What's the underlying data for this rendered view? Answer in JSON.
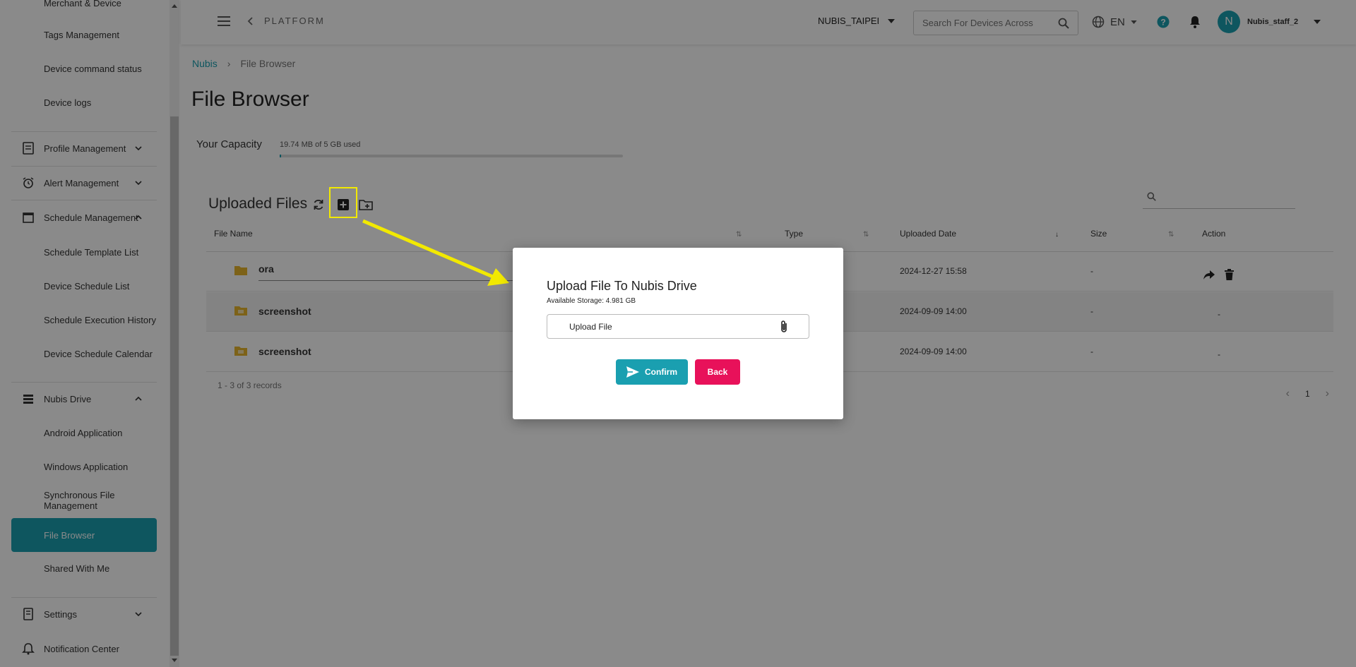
{
  "sidebar": {
    "items": [
      {
        "label": "Merchant & Device"
      },
      {
        "label": "Tags Management"
      },
      {
        "label": "Device command status"
      },
      {
        "label": "Device logs"
      },
      {
        "label": "Profile Management"
      },
      {
        "label": "Alert Management"
      },
      {
        "label": "Schedule Management"
      },
      {
        "label": "Schedule Template List"
      },
      {
        "label": "Device Schedule List"
      },
      {
        "label": "Schedule Execution History"
      },
      {
        "label": "Device Schedule Calendar"
      },
      {
        "label": "Nubis Drive"
      },
      {
        "label": "Android Application"
      },
      {
        "label": "Windows Application"
      },
      {
        "label": "Synchronous File Management"
      },
      {
        "label": "File Browser"
      },
      {
        "label": "Shared With Me"
      },
      {
        "label": "Settings"
      },
      {
        "label": "Notification Center"
      }
    ]
  },
  "topbar": {
    "back_label": "PLATFORM",
    "org": "NUBIS_TAIPEI",
    "search_placeholder": "Search For Devices Across",
    "language": "EN",
    "avatar_initial": "N",
    "username": "Nubis_staff_2"
  },
  "breadcrumb": {
    "root": "Nubis",
    "current": "File Browser"
  },
  "page": {
    "title": "File Browser"
  },
  "capacity": {
    "label": "Your Capacity",
    "usage_text": "19.74 MB of 5 GB used",
    "used_fraction": 0.004
  },
  "files": {
    "title": "Uploaded Files",
    "columns": [
      "File Name",
      "Type",
      "Uploaded Date",
      "Size",
      "Action"
    ],
    "rows": [
      {
        "name": "ora",
        "date": "2024-12-27 15:58",
        "size": "-",
        "action": ""
      },
      {
        "name": "screenshot",
        "date": "2024-09-09 14:00",
        "size": "-",
        "action": "-"
      },
      {
        "name": "screenshot",
        "date": "2024-09-09 14:00",
        "size": "-",
        "action": "-"
      }
    ],
    "records": "1 - 3 of 3 records",
    "page": "1"
  },
  "modal": {
    "title": "Upload File To Nubis Drive",
    "storage": "Available Storage: 4.981 GB",
    "upload_label": "Upload File",
    "confirm_label": "Confirm",
    "back_label": "Back"
  },
  "colors": {
    "accent": "#1a9fb0",
    "danger": "#e8115a",
    "highlight": "#f2e900"
  }
}
